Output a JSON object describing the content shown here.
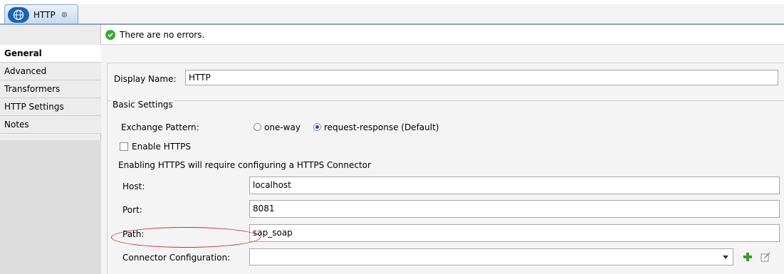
{
  "tab": {
    "label": "HTTP",
    "close": "⊗"
  },
  "status": {
    "message": "There are no errors."
  },
  "nav": {
    "items": [
      {
        "label": "General"
      },
      {
        "label": "Advanced"
      },
      {
        "label": "Transformers"
      },
      {
        "label": "HTTP Settings"
      },
      {
        "label": "Notes"
      }
    ]
  },
  "display_name": {
    "label": "Display Name:",
    "value": "HTTP"
  },
  "basic_settings": {
    "legend": "Basic Settings",
    "exchange_pattern": {
      "label": "Exchange Pattern:",
      "options": [
        "one-way",
        "request-response (Default)"
      ],
      "selected": "request-response (Default)"
    },
    "enable_https": {
      "label": "Enable HTTPS",
      "checked": false
    },
    "https_note": "Enabling HTTPS will require configuring a HTTPS Connector",
    "host": {
      "label": "Host:",
      "value": "localhost"
    },
    "port": {
      "label": "Port:",
      "value": "8081"
    },
    "path": {
      "label": "Path:",
      "value": "sap_soap"
    },
    "connector": {
      "label": "Connector Configuration:",
      "value": ""
    }
  },
  "colors": {
    "highlight": "#d42a2a",
    "ok": "#3aa83a",
    "tab_globe": "#1a63b8"
  },
  "icons": [
    "globe-icon",
    "close-icon",
    "check-icon",
    "chevron-down-icon",
    "add-icon",
    "edit-icon"
  ]
}
